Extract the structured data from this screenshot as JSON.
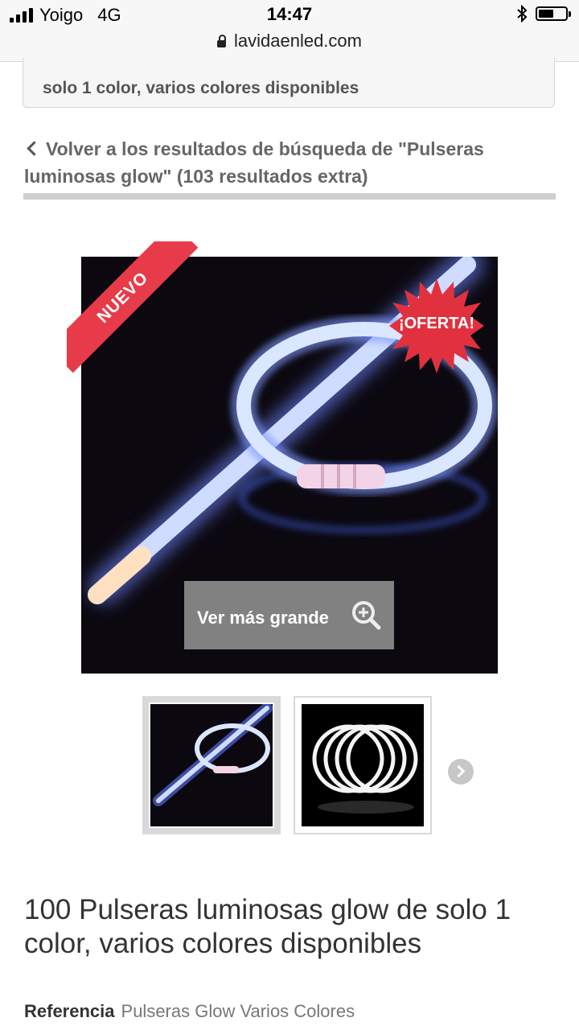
{
  "status_bar": {
    "carrier": "Yoigo",
    "network": "4G",
    "time": "14:47",
    "battery_level": 0.55,
    "url": "lavidaenled.com"
  },
  "header_box": {
    "text": "solo 1 color, varios colores disponibles"
  },
  "back_link": {
    "text": "Volver a los resultados de búsqueda de \"Pulseras luminosas glow\" (103 resultados extra)"
  },
  "product_image": {
    "new_label": "NUEVO",
    "offer_label": "¡OFERTA!",
    "zoom_label": "Ver más grande"
  },
  "thumbnails": [
    {
      "name": "glow-bracelet-blue"
    },
    {
      "name": "glow-bracelets-white"
    }
  ],
  "product": {
    "title": "100 Pulseras luminosas glow de solo 1 color, varios colores disponibles",
    "reference_label": "Referencia",
    "reference_value": "Pulseras Glow Varios Colores"
  },
  "colors": {
    "new_ribbon": "#e83b4a",
    "offer_badge": "#e2313e",
    "glow": "#dce8ff"
  }
}
